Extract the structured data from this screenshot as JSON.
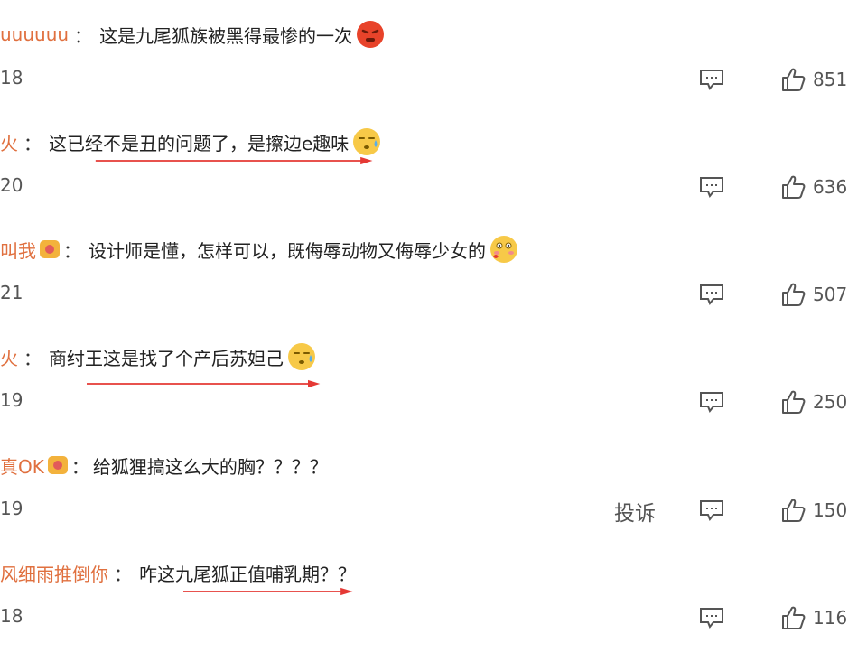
{
  "comments": [
    {
      "user": "uuuuuu",
      "sep": "：",
      "text": "这是九尾狐族被黑得最惨的一次",
      "date": "18",
      "likes": "851",
      "emoji": "angry-face-icon"
    },
    {
      "user": "火",
      "sep": "：",
      "text": "这已经不是丑的问题了，是擦边e趣味",
      "date": "20",
      "likes": "636",
      "emoji": "sweat-face-icon"
    },
    {
      "user": "叫我",
      "sep": "：",
      "text": "设计师是懂，怎样可以，既侮辱动物又侮辱少女的",
      "date": "21",
      "likes": "507",
      "emoji": "blush-face-icon"
    },
    {
      "user": "火",
      "sep": "：",
      "text": "商纣王这是找了个产后苏妲己",
      "date": "19",
      "likes": "250",
      "emoji": "sweat-face-icon"
    },
    {
      "user": "真OK",
      "sep": "：",
      "text": "给狐狸搞这么大的胸？？？？",
      "date": "19",
      "likes": "150",
      "report": "投诉"
    },
    {
      "user": "风细雨推倒你",
      "sep": "：",
      "text": "咋这九尾狐正值哺乳期？？",
      "date": "18",
      "likes": "116"
    }
  ],
  "colors": {
    "username": "#e0703f",
    "arrow": "#e53935",
    "text": "#222222",
    "meta": "#555555"
  }
}
